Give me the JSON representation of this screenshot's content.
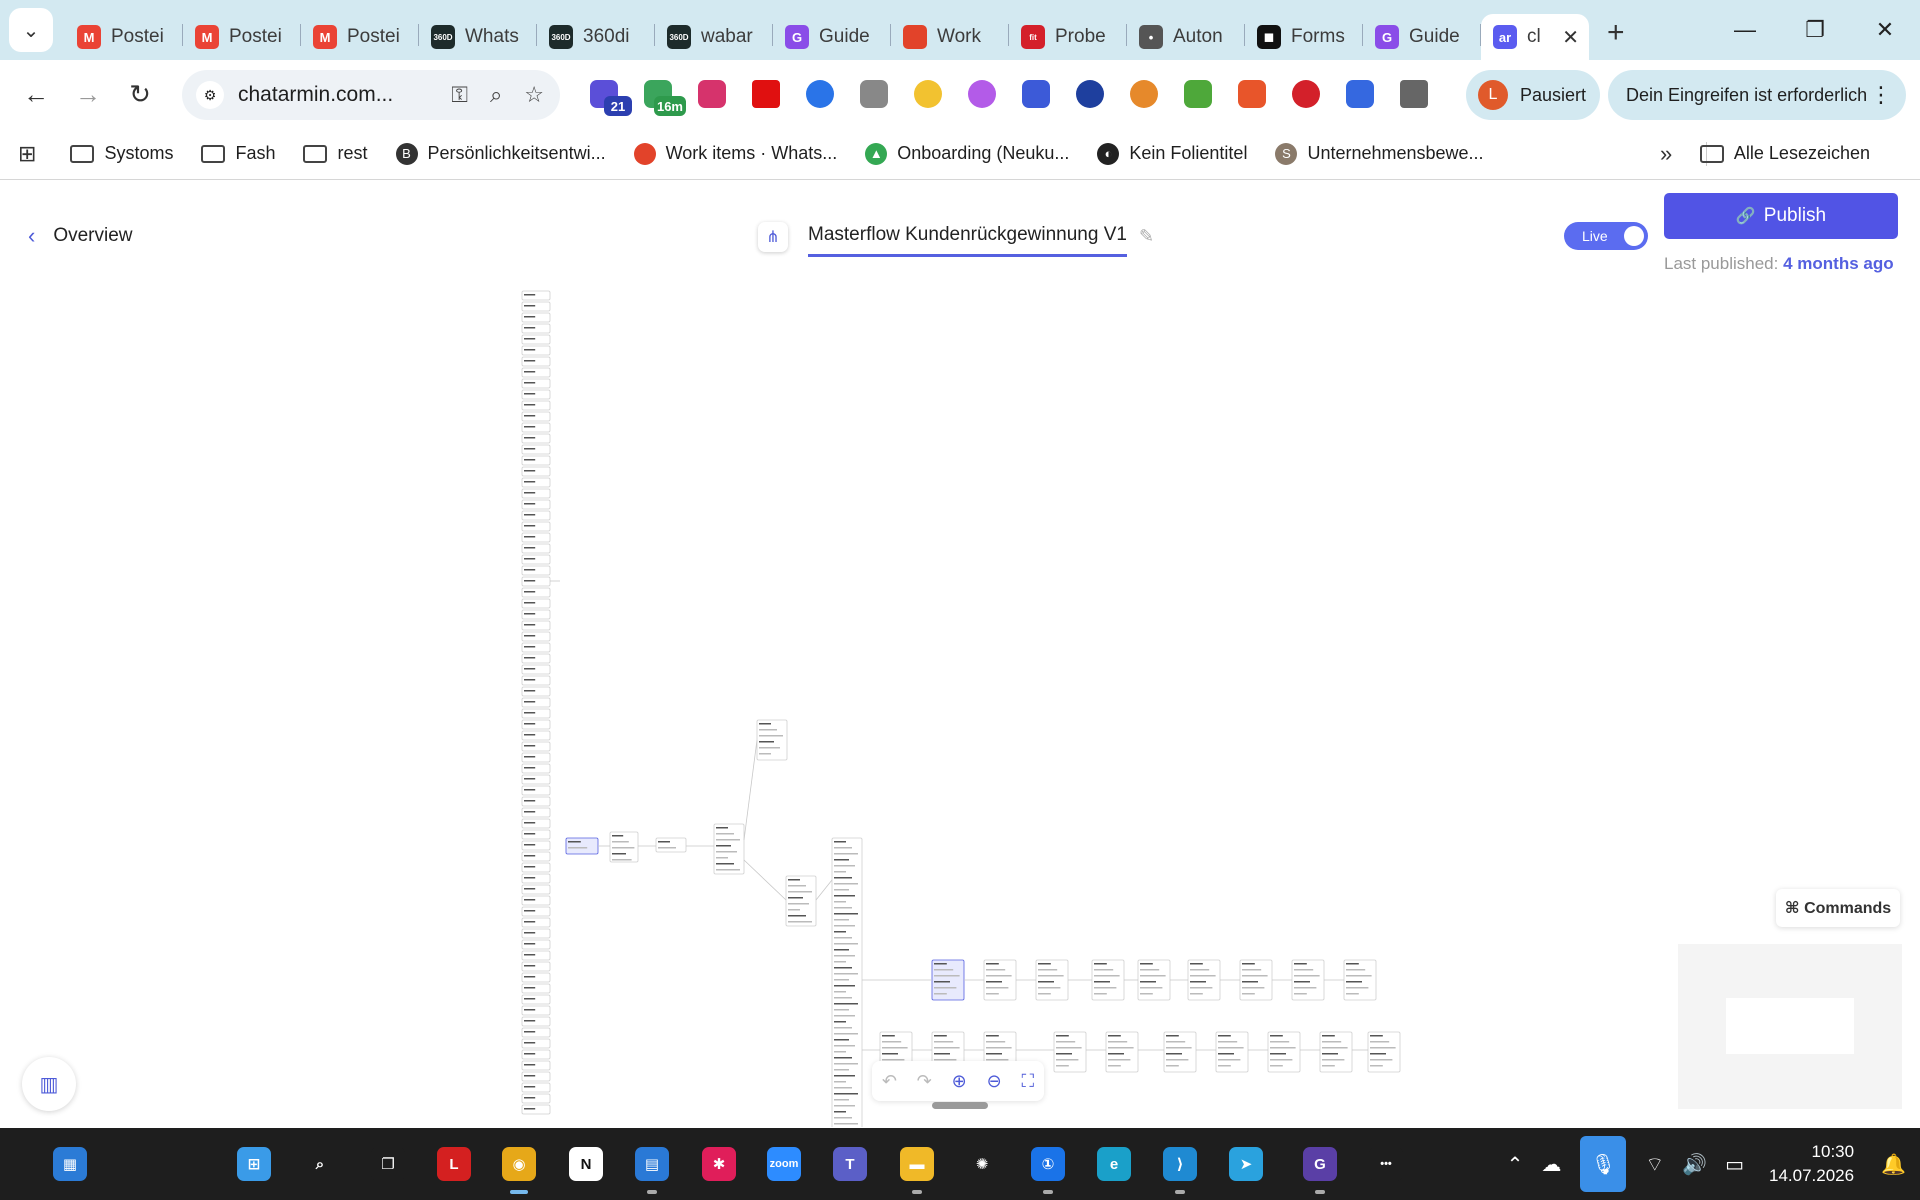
{
  "browser": {
    "tabs": [
      {
        "label": "Postei",
        "favicon": "gmail-icon",
        "color": "#ea4335",
        "glyph": "M"
      },
      {
        "label": "Postei",
        "favicon": "gmail-icon",
        "color": "#ea4335",
        "glyph": "M"
      },
      {
        "label": "Postei",
        "favicon": "gmail-icon",
        "color": "#ea4335",
        "glyph": "M"
      },
      {
        "label": "Whats",
        "favicon": "360dialog-icon",
        "color": "#1d2b2b",
        "glyph": "360D"
      },
      {
        "label": "360di",
        "favicon": "360dialog-icon",
        "color": "#1d2b2b",
        "glyph": "360D"
      },
      {
        "label": "wabar",
        "favicon": "360dialog-icon",
        "color": "#1d2b2b",
        "glyph": "360D"
      },
      {
        "label": "Guide",
        "favicon": "guide-icon",
        "color": "#8a4de8",
        "glyph": "G"
      },
      {
        "label": "Work",
        "favicon": "gitlab-icon",
        "color": "#e2432a",
        "glyph": ""
      },
      {
        "label": "Probe",
        "favicon": "fit-icon",
        "color": "#d4202a",
        "glyph": "fit"
      },
      {
        "label": "Auton",
        "favicon": "automation-icon",
        "color": "#555555",
        "glyph": "•"
      },
      {
        "label": "Forms",
        "favicon": "forms-icon",
        "color": "#111111",
        "glyph": "◼"
      },
      {
        "label": "Guide",
        "favicon": "guide-icon",
        "color": "#8a4de8",
        "glyph": "G"
      },
      {
        "label": "cl",
        "favicon": "chatarmin-icon",
        "color": "#5b5cf0",
        "glyph": "ar",
        "active": true
      }
    ],
    "url": "chatarmin.com...",
    "extensions_badge_1": "21",
    "extensions_badge_2": "16m",
    "profile_initial": "L",
    "profile_label": "Pausiert",
    "intervene_label": "Dein Eingreifen ist erforderlich",
    "bookmarks": [
      {
        "label": "Systoms",
        "icon": "folder-icon"
      },
      {
        "label": "Fash",
        "icon": "folder-icon"
      },
      {
        "label": "rest",
        "icon": "folder-icon"
      },
      {
        "label": "Persönlichkeitsentwi...",
        "icon": "b-icon",
        "color": "#333333",
        "glyph": "B"
      },
      {
        "label": "Work items · Whats...",
        "icon": "gitlab-icon",
        "color": "#e2432a",
        "glyph": ""
      },
      {
        "label": "Onboarding (Neuku...",
        "icon": "drive-icon",
        "color": "#34a853",
        "glyph": "▲"
      },
      {
        "label": "Kein Folientitel",
        "icon": "globe-icon",
        "color": "#222222",
        "glyph": "◐"
      },
      {
        "label": "Unternehmensbewe...",
        "icon": "s-icon",
        "color": "#8a7a6a",
        "glyph": "S"
      }
    ],
    "all_bookmarks_label": "Alle Lesezeichen"
  },
  "app": {
    "back_label": "Overview",
    "flow_title": "Masterflow Kundenrückgewinnung V1",
    "live_label": "Live",
    "publish_label": "Publish",
    "last_published_prefix": "Last published:",
    "last_published_value": "4 months ago",
    "commands_label": "⌘ Commands"
  },
  "taskbar": {
    "apps": [
      {
        "name": "widgets-icon",
        "color": "#2b7bd6",
        "glyph": "▦"
      },
      {
        "name": "windows-start-icon",
        "color": "#3a9be8",
        "glyph": "⊞"
      },
      {
        "name": "search-icon",
        "color": "#1e1e1e",
        "glyph": "⌕"
      },
      {
        "name": "task-view-icon",
        "color": "#1e1e1e",
        "glyph": "❐"
      },
      {
        "name": "l-app-icon",
        "color": "#d42020",
        "glyph": "L"
      },
      {
        "name": "chrome-icon",
        "color": "#e6a819",
        "glyph": "◉",
        "active": true
      },
      {
        "name": "notion-icon",
        "color": "#ffffff",
        "glyph": "N",
        "dark": true
      },
      {
        "name": "files-app-icon",
        "color": "#2a79d6",
        "glyph": "▤"
      },
      {
        "name": "slack-icon",
        "color": "#e01e5a",
        "glyph": "✱"
      },
      {
        "name": "zoom-icon",
        "color": "#2d8cff",
        "glyph": "zoom"
      },
      {
        "name": "teams-icon",
        "color": "#5b5fc7",
        "glyph": "T"
      },
      {
        "name": "file-explorer-icon",
        "color": "#f0b928",
        "glyph": "▬"
      },
      {
        "name": "chatgpt-icon",
        "color": "#1e1e1e",
        "glyph": "✺"
      },
      {
        "name": "1password-icon",
        "color": "#1a73e8",
        "glyph": "①"
      },
      {
        "name": "edge-icon",
        "color": "#1aa0c9",
        "glyph": "e"
      },
      {
        "name": "vscode-icon",
        "color": "#1f8ad2",
        "glyph": "⟩"
      },
      {
        "name": "telegram-icon",
        "color": "#2aa2de",
        "glyph": "➤"
      },
      {
        "name": "guide-app-icon",
        "color": "#5a3fa6",
        "glyph": "G"
      },
      {
        "name": "more-apps-icon",
        "color": "#1e1e1e",
        "glyph": "•••"
      }
    ],
    "time": "10:30",
    "date": "14.07.2026"
  }
}
